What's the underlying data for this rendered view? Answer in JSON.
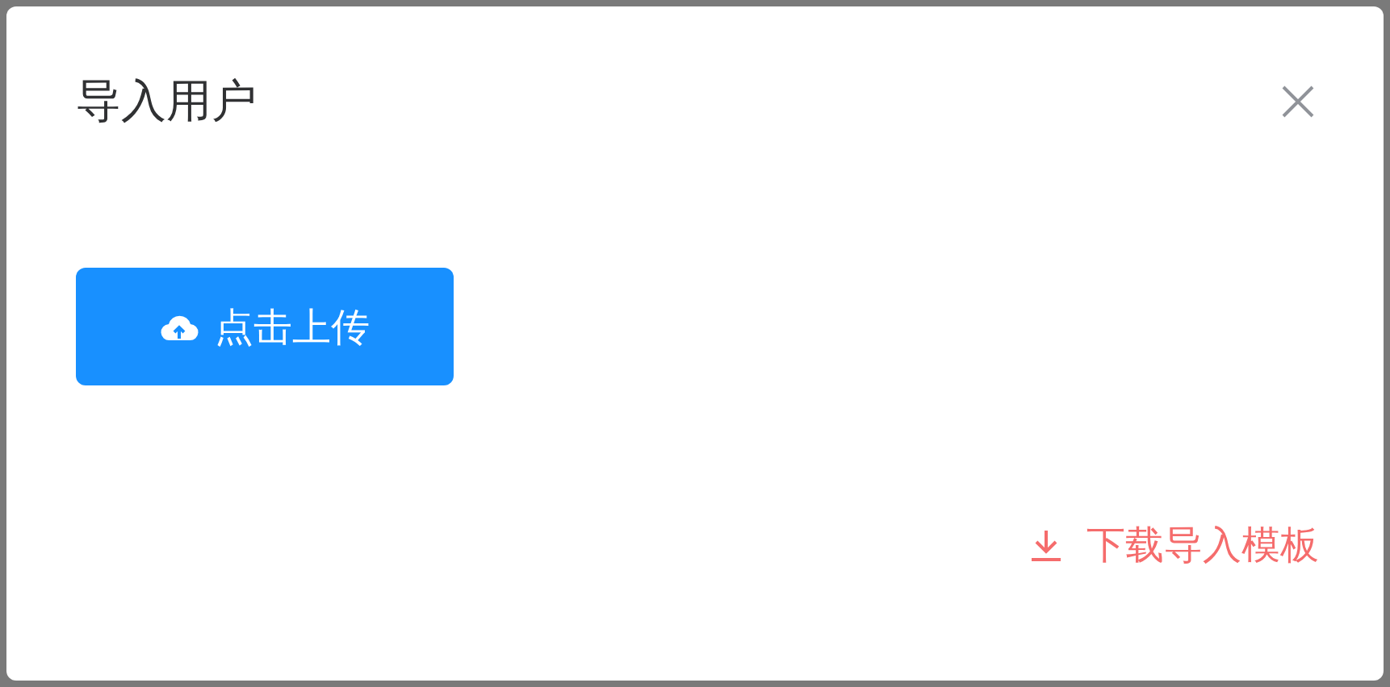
{
  "dialog": {
    "title": "导入用户",
    "upload_button": {
      "label": "点击上传"
    },
    "template_link": {
      "label": "下载导入模板"
    }
  }
}
